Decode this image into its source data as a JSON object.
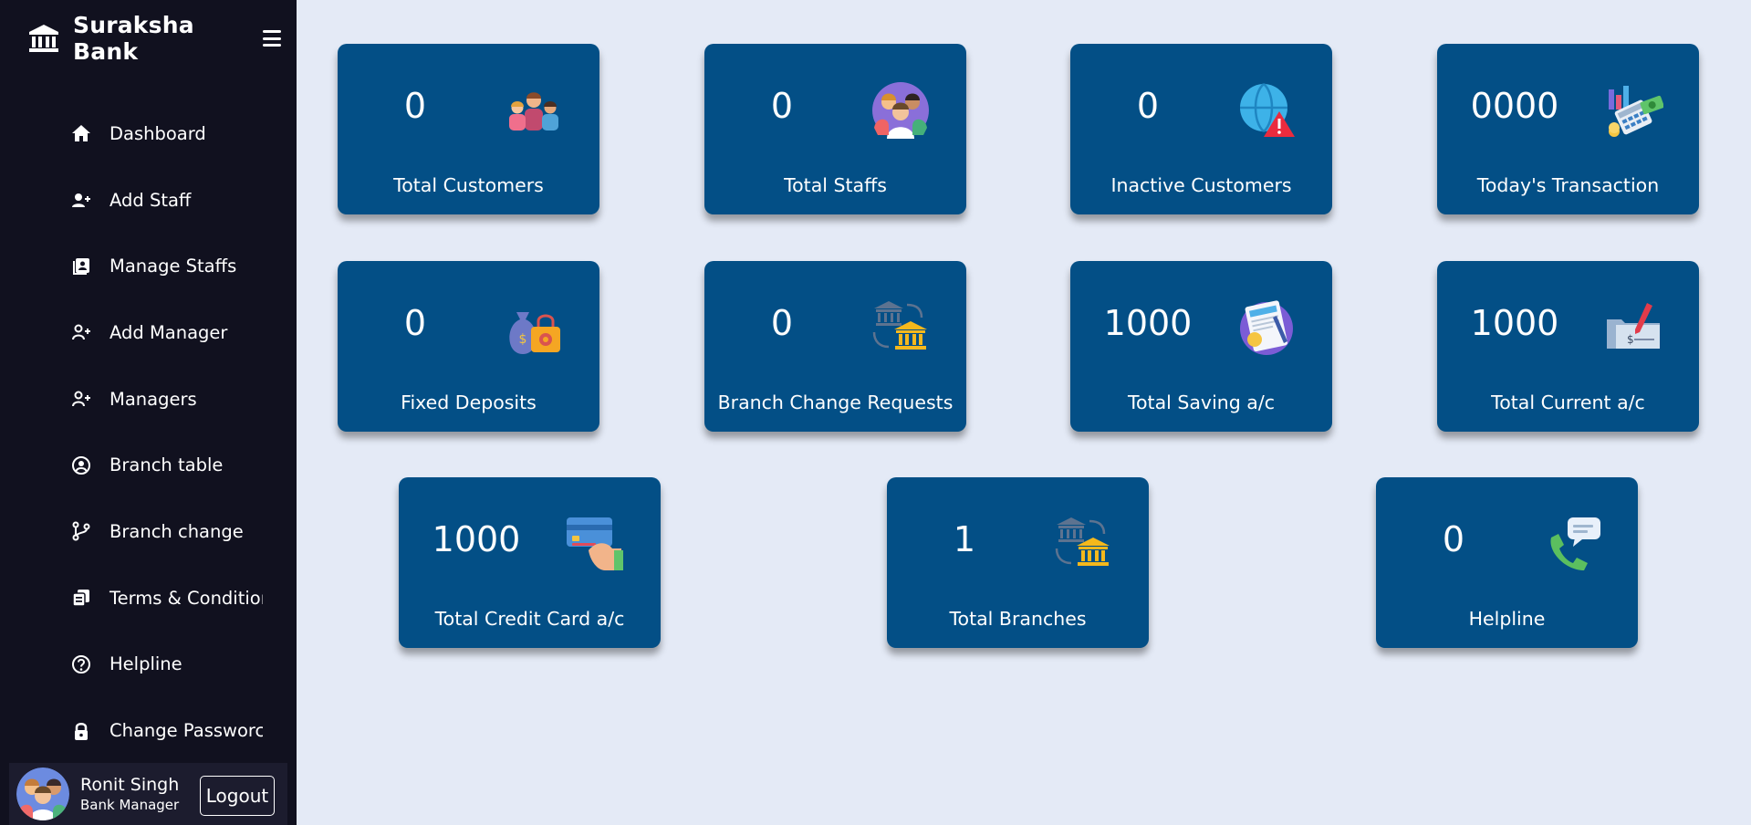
{
  "brand": {
    "name": "Suraksha Bank",
    "icon": "bank-icon"
  },
  "sidebar": {
    "items": [
      {
        "label": "Dashboard",
        "icon": "home-icon"
      },
      {
        "label": "Add Staff",
        "icon": "user-plus-icon"
      },
      {
        "label": "Manage Staffs",
        "icon": "id-badge-icon"
      },
      {
        "label": "Add Manager",
        "icon": "user-plus-icon"
      },
      {
        "label": "Managers",
        "icon": "user-plus-icon"
      },
      {
        "label": "Branch table",
        "icon": "user-circle-icon"
      },
      {
        "label": "Branch change",
        "icon": "branch-icon"
      },
      {
        "label": "Terms & Conditior",
        "icon": "documents-icon"
      },
      {
        "label": "Helpline",
        "icon": "question-circle-icon"
      },
      {
        "label": "Change Passworc",
        "icon": "lock-icon"
      }
    ]
  },
  "profile": {
    "name": "Ronit Singh",
    "role": "Bank Manager",
    "logout_label": "Logout"
  },
  "cards": [
    {
      "value": "0",
      "label": "Total Customers",
      "icon": "customers-group-icon"
    },
    {
      "value": "0",
      "label": "Total Staffs",
      "icon": "staff-avatar-icon"
    },
    {
      "value": "0",
      "label": "Inactive Customers",
      "icon": "globe-warning-icon"
    },
    {
      "value": "0000",
      "label": "Today's Transaction",
      "icon": "calculator-money-icon"
    },
    {
      "value": "0",
      "label": "Fixed Deposits",
      "icon": "money-bag-lock-icon"
    },
    {
      "value": "0",
      "label": "Branch Change Requests",
      "icon": "bank-transfer-icon"
    },
    {
      "value": "1000",
      "label": "Total Saving a/c",
      "icon": "savings-document-icon"
    },
    {
      "value": "1000",
      "label": "Total Current a/c",
      "icon": "cheque-icon"
    },
    {
      "value": "1000",
      "label": "Total Credit Card a/c",
      "icon": "credit-card-hand-icon"
    },
    {
      "value": "1",
      "label": "Total Branches",
      "icon": "bank-transfer-icon"
    },
    {
      "value": "0",
      "label": "Helpline",
      "icon": "phone-chat-icon"
    }
  ],
  "colors": {
    "sidebar_bg": "#11111f",
    "page_bg": "#e4eaf6",
    "card_bg": "#034f86"
  }
}
